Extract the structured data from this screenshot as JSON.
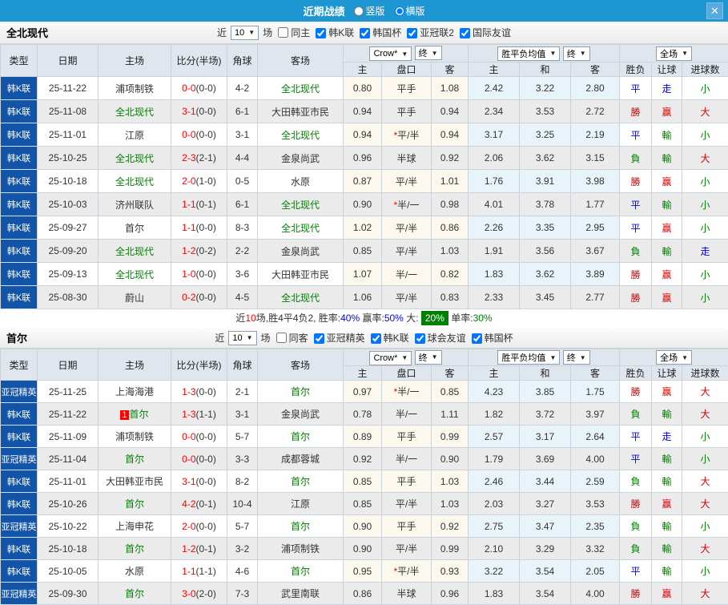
{
  "titlebar": {
    "title": "近期战绩",
    "radio_vertical": "竖版",
    "radio_horizontal": "横版",
    "close_icon": "✕"
  },
  "filter_common": {
    "near": "近",
    "count": "10",
    "matches": "场"
  },
  "columns": {
    "type": "类型",
    "date": "日期",
    "home": "主场",
    "score": "比分(半场)",
    "corner": "角球",
    "away": "客场",
    "crow_home": "主",
    "handicap": "盘口",
    "crow_away": "客",
    "avg_home": "主",
    "avg_draw": "和",
    "avg_away": "客",
    "wl": "胜负",
    "let_ball": "让球",
    "goals": "进球数",
    "crow_select": "Crow*",
    "final_select": "终",
    "avg_select": "胜平负均值",
    "scope_select": "全场"
  },
  "sections": [
    {
      "team": "全北现代",
      "same_label": "同主",
      "leagues": [
        "韩K联",
        "韩国杯",
        "亚冠联2",
        "国际友谊"
      ],
      "rows": [
        {
          "league": "韩K联",
          "date": "25-11-22",
          "home": "浦项制铁",
          "home_green": false,
          "home_badge": "",
          "score": "0-0",
          "half": "0-0",
          "corner": "4-2",
          "away": "全北现代",
          "away_green": true,
          "crow_home": "0.80",
          "handicap": "平手",
          "handicap_star": false,
          "crow_away": "1.08",
          "avg_home": "2.42",
          "avg_draw": "3.22",
          "avg_away": "2.80",
          "res_wl": "平",
          "res_let": "走",
          "res_goal": "小"
        },
        {
          "league": "韩K联",
          "date": "25-11-08",
          "home": "全北现代",
          "home_green": true,
          "home_badge": "",
          "score": "3-1",
          "half": "0-0",
          "corner": "6-1",
          "away": "大田韩亚市民",
          "away_green": false,
          "crow_home": "0.94",
          "handicap": "平手",
          "handicap_star": false,
          "crow_away": "0.94",
          "avg_home": "2.34",
          "avg_draw": "3.53",
          "avg_away": "2.72",
          "res_wl": "勝",
          "res_let": "赢",
          "res_goal": "大"
        },
        {
          "league": "韩K联",
          "date": "25-11-01",
          "home": "江原",
          "home_green": false,
          "home_badge": "",
          "score": "0-0",
          "half": "0-0",
          "corner": "3-1",
          "away": "全北现代",
          "away_green": true,
          "crow_home": "0.94",
          "handicap": "平/半",
          "handicap_star": true,
          "crow_away": "0.94",
          "avg_home": "3.17",
          "avg_draw": "3.25",
          "avg_away": "2.19",
          "res_wl": "平",
          "res_let": "輸",
          "res_goal": "小"
        },
        {
          "league": "韩K联",
          "date": "25-10-25",
          "home": "全北现代",
          "home_green": true,
          "home_badge": "",
          "score": "2-3",
          "half": "2-1",
          "corner": "4-4",
          "away": "金泉尚武",
          "away_green": false,
          "crow_home": "0.96",
          "handicap": "半球",
          "handicap_star": false,
          "crow_away": "0.92",
          "avg_home": "2.06",
          "avg_draw": "3.62",
          "avg_away": "3.15",
          "res_wl": "負",
          "res_let": "輸",
          "res_goal": "大"
        },
        {
          "league": "韩K联",
          "date": "25-10-18",
          "home": "全北现代",
          "home_green": true,
          "home_badge": "",
          "score": "2-0",
          "half": "1-0",
          "corner": "0-5",
          "away": "水原",
          "away_green": false,
          "crow_home": "0.87",
          "handicap": "平/半",
          "handicap_star": false,
          "crow_away": "1.01",
          "avg_home": "1.76",
          "avg_draw": "3.91",
          "avg_away": "3.98",
          "res_wl": "勝",
          "res_let": "赢",
          "res_goal": "小"
        },
        {
          "league": "韩K联",
          "date": "25-10-03",
          "home": "济州联队",
          "home_green": false,
          "home_badge": "",
          "score": "1-1",
          "half": "0-1",
          "corner": "6-1",
          "away": "全北现代",
          "away_green": true,
          "crow_home": "0.90",
          "handicap": "半/一",
          "handicap_star": true,
          "crow_away": "0.98",
          "avg_home": "4.01",
          "avg_draw": "3.78",
          "avg_away": "1.77",
          "res_wl": "平",
          "res_let": "輸",
          "res_goal": "小"
        },
        {
          "league": "韩K联",
          "date": "25-09-27",
          "home": "首尔",
          "home_green": false,
          "home_badge": "",
          "score": "1-1",
          "half": "0-0",
          "corner": "8-3",
          "away": "全北现代",
          "away_green": true,
          "crow_home": "1.02",
          "handicap": "平/半",
          "handicap_star": false,
          "crow_away": "0.86",
          "avg_home": "2.26",
          "avg_draw": "3.35",
          "avg_away": "2.95",
          "res_wl": "平",
          "res_let": "赢",
          "res_goal": "小"
        },
        {
          "league": "韩K联",
          "date": "25-09-20",
          "home": "全北现代",
          "home_green": true,
          "home_badge": "",
          "score": "1-2",
          "half": "0-2",
          "corner": "2-2",
          "away": "金泉尚武",
          "away_green": false,
          "crow_home": "0.85",
          "handicap": "平/半",
          "handicap_star": false,
          "crow_away": "1.03",
          "avg_home": "1.91",
          "avg_draw": "3.56",
          "avg_away": "3.67",
          "res_wl": "負",
          "res_let": "輸",
          "res_goal": "走"
        },
        {
          "league": "韩K联",
          "date": "25-09-13",
          "home": "全北现代",
          "home_green": true,
          "home_badge": "",
          "score": "1-0",
          "half": "0-0",
          "corner": "3-6",
          "away": "大田韩亚市民",
          "away_green": false,
          "crow_home": "1.07",
          "handicap": "半/一",
          "handicap_star": false,
          "crow_away": "0.82",
          "avg_home": "1.83",
          "avg_draw": "3.62",
          "avg_away": "3.89",
          "res_wl": "勝",
          "res_let": "赢",
          "res_goal": "小"
        },
        {
          "league": "韩K联",
          "date": "25-08-30",
          "home": "蔚山",
          "home_green": false,
          "home_badge": "",
          "score": "0-2",
          "half": "0-0",
          "corner": "4-5",
          "away": "全北现代",
          "away_green": true,
          "crow_home": "1.06",
          "handicap": "平/半",
          "handicap_star": false,
          "crow_away": "0.83",
          "avg_home": "2.33",
          "avg_draw": "3.45",
          "avg_away": "2.77",
          "res_wl": "勝",
          "res_let": "赢",
          "res_goal": "小"
        }
      ],
      "summary_parts": [
        {
          "t": "近",
          "c": ""
        },
        {
          "t": "10",
          "c": "red"
        },
        {
          "t": "场,胜4平4负2, 胜率:",
          "c": ""
        },
        {
          "t": "40%",
          "c": "blue"
        },
        {
          "t": " 赢率:",
          "c": ""
        },
        {
          "t": "50%",
          "c": "blue"
        },
        {
          "t": " 大: ",
          "c": ""
        },
        {
          "t": "20%",
          "c": "bigbadge"
        },
        {
          "t": " 单率:",
          "c": ""
        },
        {
          "t": "30%",
          "c": "green"
        }
      ]
    },
    {
      "team": "首尔",
      "same_label": "同客",
      "leagues": [
        "亚冠精英",
        "韩K联",
        "球会友谊",
        "韩国杯"
      ],
      "rows": [
        {
          "league": "亚冠精英",
          "date": "25-11-25",
          "home": "上海海港",
          "home_green": false,
          "home_badge": "",
          "score": "1-3",
          "half": "0-0",
          "corner": "2-1",
          "away": "首尔",
          "away_green": true,
          "crow_home": "0.97",
          "handicap": "半/一",
          "handicap_star": true,
          "crow_away": "0.85",
          "avg_home": "4.23",
          "avg_draw": "3.85",
          "avg_away": "1.75",
          "res_wl": "勝",
          "res_let": "赢",
          "res_goal": "大"
        },
        {
          "league": "韩K联",
          "date": "25-11-22",
          "home": "首尔",
          "home_green": true,
          "home_badge": "1",
          "score": "1-3",
          "half": "1-1",
          "corner": "3-1",
          "away": "金泉尚武",
          "away_green": false,
          "crow_home": "0.78",
          "handicap": "半/一",
          "handicap_star": false,
          "crow_away": "1.11",
          "avg_home": "1.82",
          "avg_draw": "3.72",
          "avg_away": "3.97",
          "res_wl": "負",
          "res_let": "輸",
          "res_goal": "大"
        },
        {
          "league": "韩K联",
          "date": "25-11-09",
          "home": "浦项制铁",
          "home_green": false,
          "home_badge": "",
          "score": "0-0",
          "half": "0-0",
          "corner": "5-7",
          "away": "首尔",
          "away_green": true,
          "crow_home": "0.89",
          "handicap": "平手",
          "handicap_star": false,
          "crow_away": "0.99",
          "avg_home": "2.57",
          "avg_draw": "3.17",
          "avg_away": "2.64",
          "res_wl": "平",
          "res_let": "走",
          "res_goal": "小"
        },
        {
          "league": "亚冠精英",
          "date": "25-11-04",
          "home": "首尔",
          "home_green": true,
          "home_badge": "",
          "score": "0-0",
          "half": "0-0",
          "corner": "3-3",
          "away": "成都蓉城",
          "away_green": false,
          "crow_home": "0.92",
          "handicap": "半/一",
          "handicap_star": false,
          "crow_away": "0.90",
          "avg_home": "1.79",
          "avg_draw": "3.69",
          "avg_away": "4.00",
          "res_wl": "平",
          "res_let": "輸",
          "res_goal": "小"
        },
        {
          "league": "韩K联",
          "date": "25-11-01",
          "home": "大田韩亚市民",
          "home_green": false,
          "home_badge": "",
          "score": "3-1",
          "half": "0-0",
          "corner": "8-2",
          "away": "首尔",
          "away_green": true,
          "crow_home": "0.85",
          "handicap": "平手",
          "handicap_star": false,
          "crow_away": "1.03",
          "avg_home": "2.46",
          "avg_draw": "3.44",
          "avg_away": "2.59",
          "res_wl": "負",
          "res_let": "輸",
          "res_goal": "大"
        },
        {
          "league": "韩K联",
          "date": "25-10-26",
          "home": "首尔",
          "home_green": true,
          "home_badge": "",
          "score": "4-2",
          "half": "0-1",
          "corner": "10-4",
          "away": "江原",
          "away_green": false,
          "crow_home": "0.85",
          "handicap": "平/半",
          "handicap_star": false,
          "crow_away": "1.03",
          "avg_home": "2.03",
          "avg_draw": "3.27",
          "avg_away": "3.53",
          "res_wl": "勝",
          "res_let": "赢",
          "res_goal": "大"
        },
        {
          "league": "亚冠精英",
          "date": "25-10-22",
          "home": "上海申花",
          "home_green": false,
          "home_badge": "",
          "score": "2-0",
          "half": "0-0",
          "corner": "5-7",
          "away": "首尔",
          "away_green": true,
          "crow_home": "0.90",
          "handicap": "平手",
          "handicap_star": false,
          "crow_away": "0.92",
          "avg_home": "2.75",
          "avg_draw": "3.47",
          "avg_away": "2.35",
          "res_wl": "負",
          "res_let": "輸",
          "res_goal": "小"
        },
        {
          "league": "韩K联",
          "date": "25-10-18",
          "home": "首尔",
          "home_green": true,
          "home_badge": "",
          "score": "1-2",
          "half": "0-1",
          "corner": "3-2",
          "away": "浦项制铁",
          "away_green": false,
          "crow_home": "0.90",
          "handicap": "平/半",
          "handicap_star": false,
          "crow_away": "0.99",
          "avg_home": "2.10",
          "avg_draw": "3.29",
          "avg_away": "3.32",
          "res_wl": "負",
          "res_let": "輸",
          "res_goal": "大"
        },
        {
          "league": "韩K联",
          "date": "25-10-05",
          "home": "水原",
          "home_green": false,
          "home_badge": "",
          "score": "1-1",
          "half": "1-1",
          "corner": "4-6",
          "away": "首尔",
          "away_green": true,
          "crow_home": "0.95",
          "handicap": "平/半",
          "handicap_star": true,
          "crow_away": "0.93",
          "avg_home": "3.22",
          "avg_draw": "3.54",
          "avg_away": "2.05",
          "res_wl": "平",
          "res_let": "輸",
          "res_goal": "小"
        },
        {
          "league": "亚冠精英",
          "date": "25-09-30",
          "home": "首尔",
          "home_green": true,
          "home_badge": "",
          "score": "3-0",
          "half": "2-0",
          "corner": "7-3",
          "away": "武里南联",
          "away_green": false,
          "crow_home": "0.86",
          "handicap": "半球",
          "handicap_star": false,
          "crow_away": "0.96",
          "avg_home": "1.83",
          "avg_draw": "3.54",
          "avg_away": "4.00",
          "res_wl": "勝",
          "res_let": "赢",
          "res_goal": "大"
        }
      ]
    }
  ]
}
